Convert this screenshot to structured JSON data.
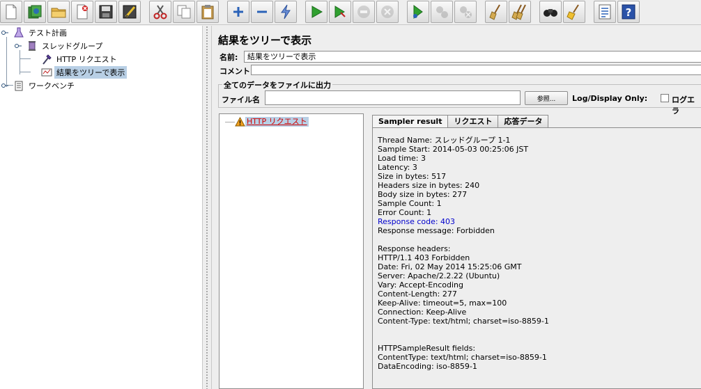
{
  "toolbar": {
    "buttons": [
      {
        "name": "new-icon"
      },
      {
        "name": "templates-icon"
      },
      {
        "name": "open-icon"
      },
      {
        "name": "close-icon"
      },
      {
        "name": "save-icon"
      },
      {
        "name": "save-as-icon"
      },
      {
        "name": "cut-icon"
      },
      {
        "name": "copy-icon"
      },
      {
        "name": "paste-icon"
      },
      {
        "name": "expand-icon"
      },
      {
        "name": "collapse-icon"
      },
      {
        "name": "toggle-icon"
      },
      {
        "name": "start-icon"
      },
      {
        "name": "start-no-pause-icon"
      },
      {
        "name": "stop-icon"
      },
      {
        "name": "shutdown-icon"
      },
      {
        "name": "remote-start-icon"
      },
      {
        "name": "remote-stop-icon"
      },
      {
        "name": "remote-shutdown-icon"
      },
      {
        "name": "clear-icon"
      },
      {
        "name": "clear-all-icon"
      },
      {
        "name": "search-icon"
      },
      {
        "name": "reset-search-icon"
      },
      {
        "name": "function-helper-icon"
      },
      {
        "name": "help-icon"
      }
    ]
  },
  "tree": {
    "test_plan": "テスト計画",
    "thread_group": "スレッドグループ",
    "http_request": "HTTP リクエスト",
    "view_results_tree": "結果をツリーで表示",
    "workbench": "ワークベンチ"
  },
  "panel": {
    "title": "結果をツリーで表示",
    "name_label": "名前:",
    "name_value": "結果をツリーで表示",
    "comment_label": "コメント:",
    "comment_value": "",
    "group_title": "全てのデータをファイルに出力",
    "file_label": "ファイル名",
    "file_value": "",
    "browse_label": "参照...",
    "log_display_label": "Log/Display Only:",
    "errors_label": "ログエラ"
  },
  "results": {
    "items": [
      {
        "label": "HTTP リクエスト",
        "status": "warning"
      }
    ]
  },
  "tabs": [
    "Sampler result",
    "リクエスト",
    "応答データ"
  ],
  "sampler_result": {
    "lines": [
      "Thread Name: スレッドグループ 1-1",
      "Sample Start: 2014-05-03 00:25:06 JST",
      "Load time: 3",
      "Latency: 3",
      "Size in bytes: 517",
      "Headers size in bytes: 240",
      "Body size in bytes: 277",
      "Sample Count: 1",
      "Error Count: 1",
      "Response code: 403",
      "Response message: Forbidden",
      "",
      "Response headers:",
      "HTTP/1.1 403 Forbidden",
      "Date: Fri, 02 May 2014 15:25:06 GMT",
      "Server: Apache/2.2.22 (Ubuntu)",
      "Vary: Accept-Encoding",
      "Content-Length: 277",
      "Keep-Alive: timeout=5, max=100",
      "Connection: Keep-Alive",
      "Content-Type: text/html; charset=iso-8859-1",
      "",
      "",
      "HTTPSampleResult fields:",
      "ContentType: text/html; charset=iso-8859-1",
      "DataEncoding: iso-8859-1"
    ],
    "highlight_line": 9,
    "highlight_color": "#0000cc"
  },
  "colors": {
    "selection": "#b8cfe5",
    "error_text": "#d00000"
  }
}
